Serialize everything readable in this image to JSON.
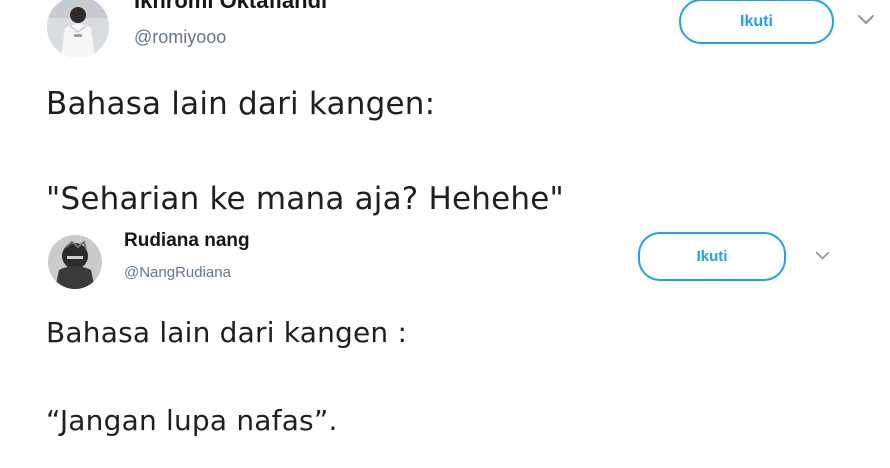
{
  "tweets": [
    {
      "display_name": "Ikhromi Oktafiandi",
      "handle": "@romiyooo",
      "follow_label": "Ikuti",
      "avatar_icon": "user-photo-avatar",
      "caret_icon": "chevron-down-icon",
      "lines": [
        "Bahasa lain dari kangen:",
        "\"Seharian ke mana aja? Hehehe\""
      ]
    },
    {
      "display_name": "Rudiana nang",
      "handle": "@NangRudiana",
      "follow_label": "Ikuti",
      "avatar_icon": "user-photo-avatar",
      "caret_icon": "chevron-down-icon",
      "lines": [
        "Bahasa lain dari kangen :",
        "“Jangan lupa nafas”."
      ]
    }
  ],
  "colors": {
    "accent": "#1da1f2",
    "text": "#1c2022",
    "secondary_text": "#657786",
    "background": "#ffffff"
  }
}
